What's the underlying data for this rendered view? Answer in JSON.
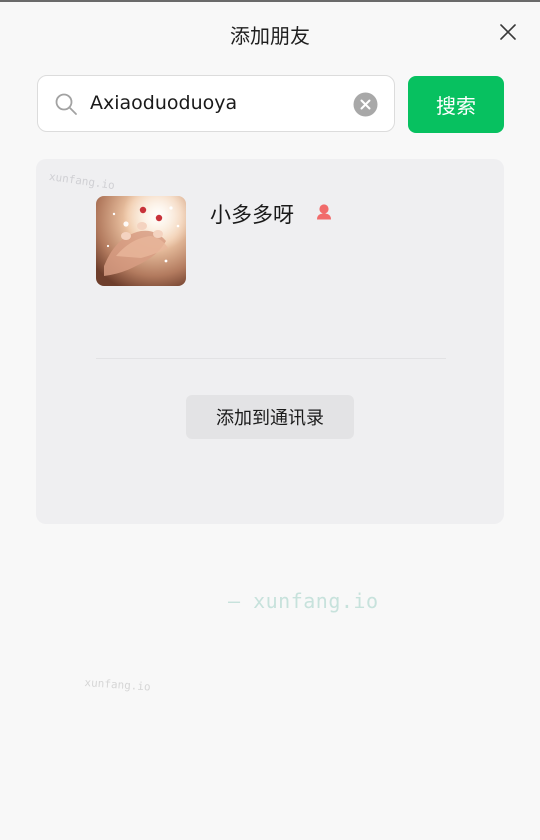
{
  "header": {
    "title": "添加朋友",
    "close_icon": "close-icon"
  },
  "search": {
    "value": "Axiaoduoduoya",
    "button_label": "搜索",
    "search_icon": "search-icon",
    "clear_icon": "clear-icon"
  },
  "result": {
    "name": "小多多呀",
    "gender_icon": "female-user-icon",
    "add_button_label": "添加到通讯录"
  },
  "watermarks": {
    "top": "xunfang.io",
    "center": "— xunfang.io",
    "bottom": "xunfang.io"
  },
  "colors": {
    "accent": "#07c160",
    "gender_female": "#f16b6b",
    "card_background": "#efeff1",
    "page_background": "#f8f8f8"
  }
}
